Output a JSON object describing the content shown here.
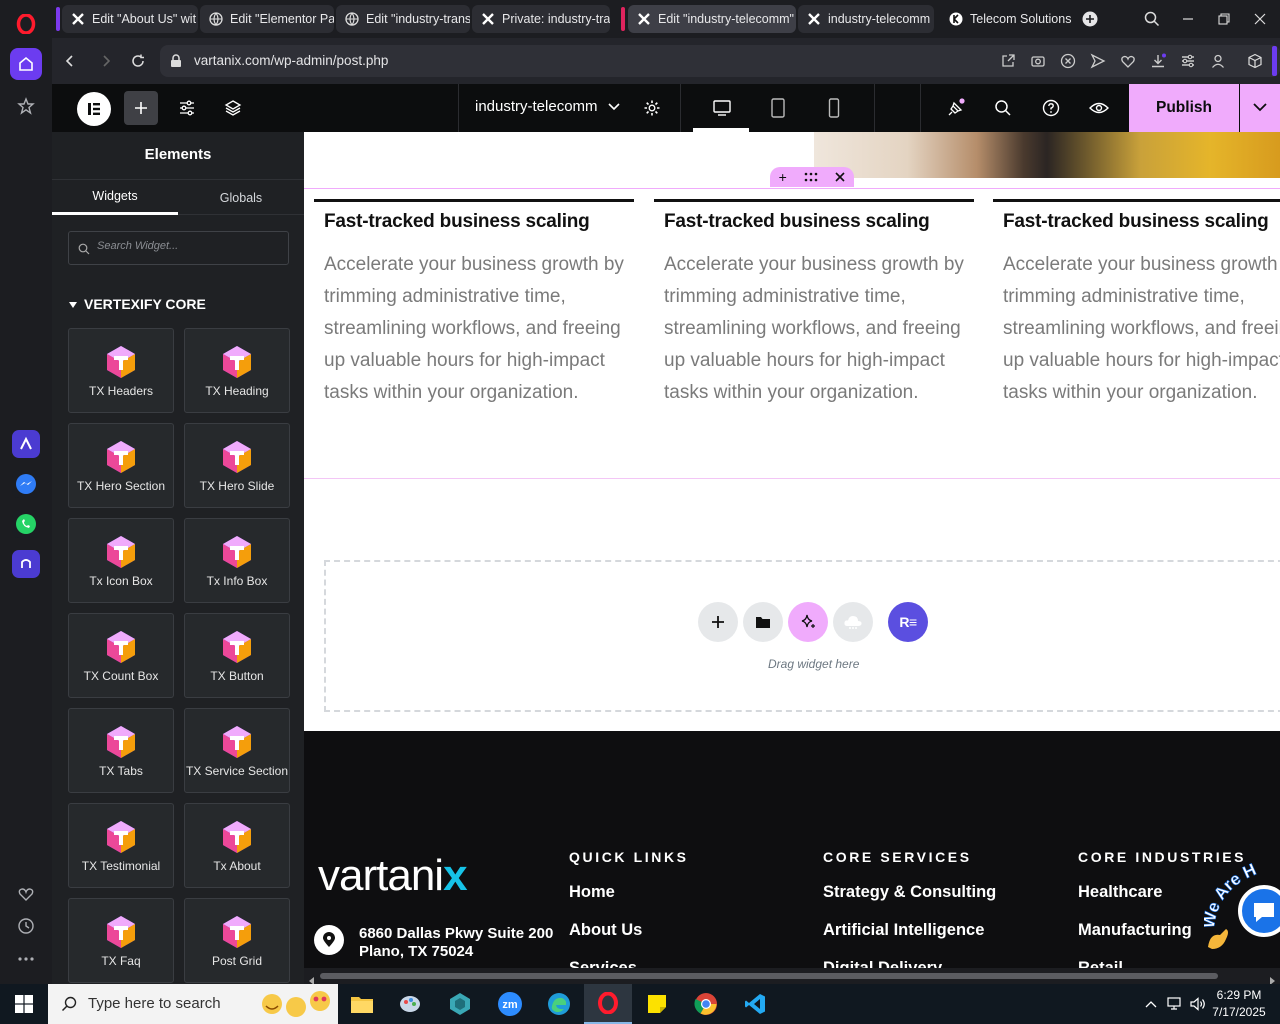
{
  "browser": {
    "tabs": [
      {
        "label": "Edit \"About Us\" wit",
        "icon": "x-icon"
      },
      {
        "label": "Edit \"Elementor Pag",
        "icon": "globe-icon"
      },
      {
        "label": "Edit \"industry-trans",
        "icon": "globe-icon"
      },
      {
        "label": "Private: industry-tra",
        "icon": "x-icon"
      },
      {
        "label": "Edit \"industry-telecomm\"",
        "icon": "x-icon"
      },
      {
        "label": "industry-telecomm",
        "icon": "x-icon"
      },
      {
        "label": "Telecom Solutions -",
        "icon": "telecom-icon"
      }
    ],
    "url": "vartanix.com/wp-admin/post.php",
    "colors": {
      "group_red": "#e0245e",
      "group_purple": "#7c3aed",
      "opera_red": "#ff1b2d"
    }
  },
  "elementor": {
    "page_name": "industry-telecomm",
    "publish_label": "Publish",
    "colors": {
      "accent": "#f0abfc"
    }
  },
  "panel": {
    "title": "Elements",
    "tabs": [
      "Widgets",
      "Globals"
    ],
    "search_placeholder": "Search Widget...",
    "category": "VERTEXIFY CORE",
    "widgets": [
      "TX Headers",
      "TX Heading",
      "TX Hero Section",
      "TX Hero Slide",
      "Tx Icon Box",
      "Tx Info Box",
      "TX Count Box",
      "TX Button",
      "TX Tabs",
      "TX Service Section",
      "TX Testimonial",
      "Tx About",
      "TX Faq",
      "Post Grid"
    ]
  },
  "canvas": {
    "columns": [
      {
        "heading": "Fast-tracked business scaling",
        "text": "Accelerate your business growth by trimming administrative time, streamlining workflows, and freeing up valuable hours for high-impact tasks within your organization."
      },
      {
        "heading": "Fast-tracked business scaling",
        "text": "Accelerate your business growth by trimming administrative time, streamlining workflows, and freeing up valuable hours for high-impact tasks within your organization."
      },
      {
        "heading": "Fast-tracked business scaling",
        "text": "Accelerate your business growth by trimming administrative time, streamlining workflows, and freeing up valuable hours for high-impact tasks within your organization."
      }
    ],
    "drop_text": "Drag widget here",
    "dropzone_buttons": [
      "add-icon",
      "folder-icon",
      "ai-sparkle-icon",
      "cloud-icon",
      "re-icon"
    ]
  },
  "footer": {
    "logo_text": "vartani",
    "logo_x": "x",
    "address_line1": "6860 Dallas Pkwy Suite 200",
    "address_line2": "Plano, TX 75024",
    "quick_links": {
      "title": "QUICK LINKS",
      "items": [
        "Home",
        "About Us",
        "Services"
      ]
    },
    "core_services": {
      "title": "CORE SERVICES",
      "items": [
        "Strategy & Consulting",
        "Artificial Intelligence",
        "Digital Delivery"
      ]
    },
    "core_industries": {
      "title": "CORE INDUSTRIES",
      "items": [
        "Healthcare",
        "Manufacturing",
        "Retail"
      ]
    },
    "badge_text": "We Are H"
  },
  "taskbar": {
    "search_placeholder": "Type here to search",
    "time": "6:29 PM",
    "date": "7/17/2025"
  }
}
